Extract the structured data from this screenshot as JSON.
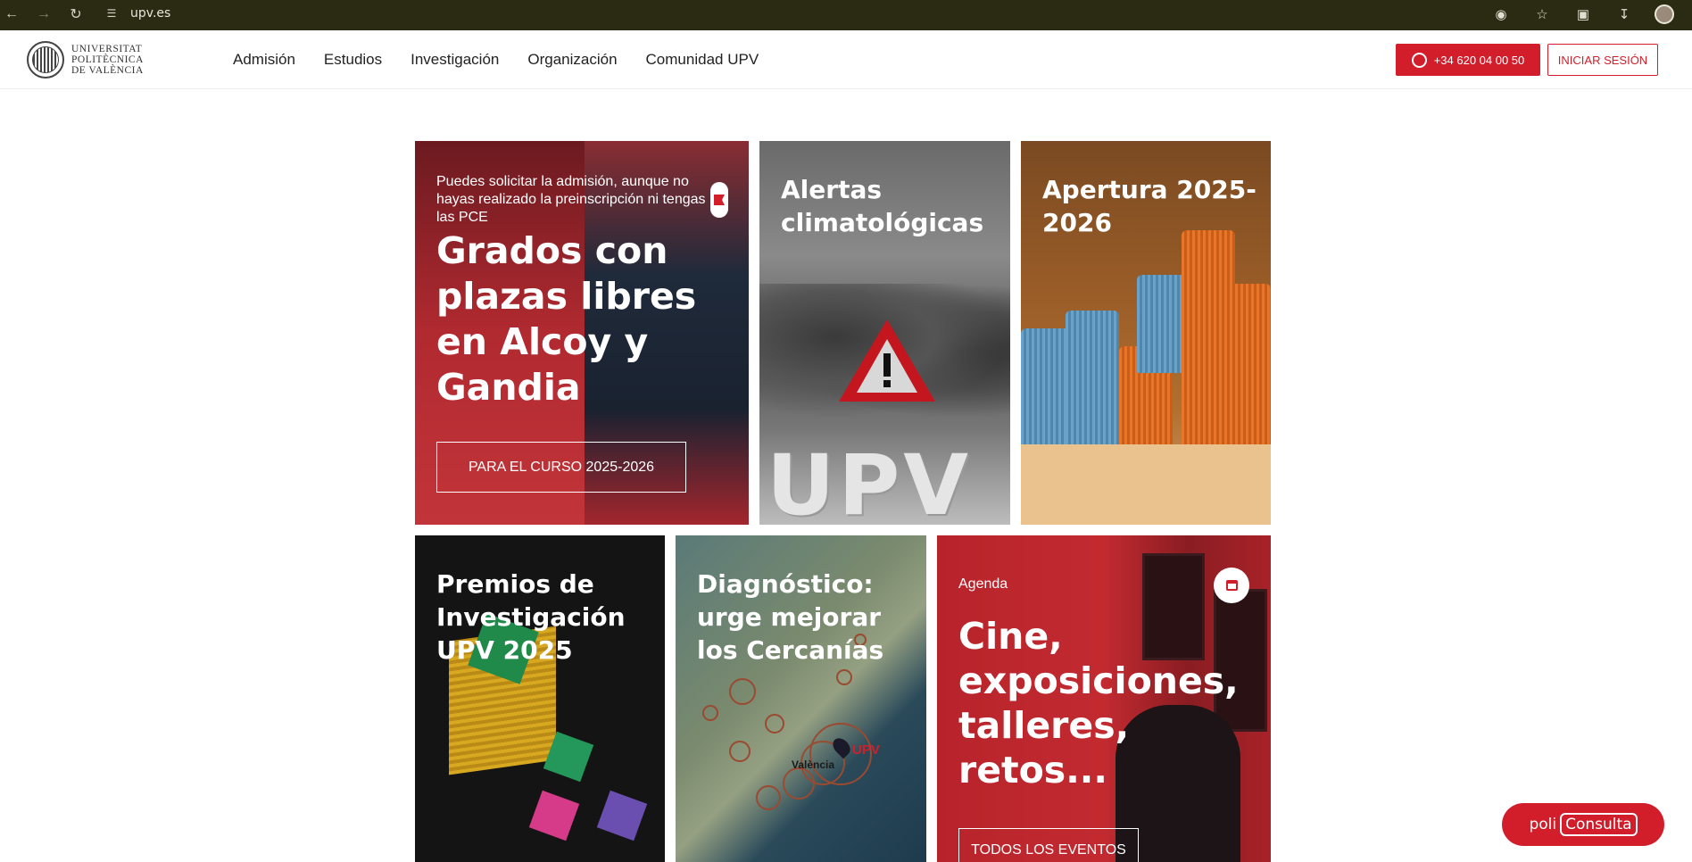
{
  "browser": {
    "url": "upv.es",
    "icons": [
      "back-icon",
      "forward-icon",
      "reload-icon",
      "site-settings-icon",
      "eye-off-icon",
      "star-icon",
      "extensions-icon",
      "download-icon",
      "profile-avatar"
    ]
  },
  "header": {
    "logo_lines": [
      "UNIVERSITAT",
      "POLITÈCNICA",
      "DE VALÈNCIA"
    ],
    "nav": [
      "Admisión",
      "Estudios",
      "Investigación",
      "Organización",
      "Comunidad UPV"
    ],
    "phone_label": "+34 620 04 00 50",
    "login_label": "INICIAR SESIÓN",
    "accent_color": "#d21e2b"
  },
  "cards": {
    "grados": {
      "intro": "Puedes solicitar la admisión, aunque no hayas realizado la preinscripción ni tengas las PCE",
      "title": "Grados con plazas libres en Alcoy y Gandia",
      "cta": "PARA EL CURSO 2025-2026"
    },
    "alertas": {
      "title": "Alertas climatológicas",
      "sign_text": "UPV"
    },
    "apertura": {
      "title": "Apertura 2025-2026"
    },
    "premios": {
      "title": "Premios de Investigación UPV 2025"
    },
    "diagnostico": {
      "title": "Diagnóstico: urge mejorar los Cercanías",
      "map_upv": "UPV",
      "map_city": "València"
    },
    "agenda": {
      "kicker": "Agenda",
      "title": "Cine, exposiciones, talleres, retos...",
      "cta": "TODOS LOS EVENTOS"
    }
  },
  "policonsulta": {
    "prefix": "poli",
    "boxed": "Consulta"
  }
}
